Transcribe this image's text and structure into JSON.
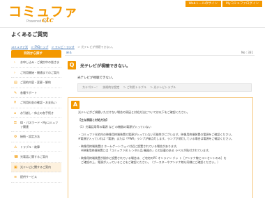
{
  "header": {
    "logo_text": "コミュファ",
    "logo_sub": "Powered by",
    "logo_ctc": "ctc",
    "buttons": [
      "Webトールのサイン",
      "Myコミュファログイン"
    ]
  },
  "page_title": "よくあるご質問",
  "breadcrumb": [
    "コミュファ光",
    "＞ FAQトップ",
    "＞ テレビ・ラジオ",
    "＞ 光テレビが視聴できない。"
  ],
  "sidebar": {
    "heading": "目的から探す",
    "items": [
      {
        "label": "お申し込み・ご検討中の皆さま"
      },
      {
        "label": "ご利用開始・開通までのご案内"
      },
      {
        "label": "ご契約内容・変更・解約"
      },
      {
        "label": "各種サポート"
      },
      {
        "label": "ご利用料金の確認・お支払い"
      },
      {
        "label": "お引越し・休止の各手続き"
      },
      {
        "label": "ID・パスワード・Myコミュファ関連"
      },
      {
        "label": "接続・設定方法"
      },
      {
        "label": "トラブル・故障"
      },
      {
        "label": "光電話に関するご案内"
      },
      {
        "label": "光テレビに関するご案内"
      },
      {
        "label": "提供サービス"
      }
    ]
  },
  "main": {
    "back_label": "戻る",
    "faq_no": "No : 331",
    "question_badge": "Q",
    "question": "光テレビが視聴できない。",
    "question_sub": "光テレビが視聴できない。",
    "categories": [
      "カテゴリー：",
      "技術的な設定",
      "＞ ご利用トラブル",
      "＞ 光テレビトラブル"
    ],
    "answer_badge": "A",
    "answer_lines": [
      "光テレビがご視聴いただけない場合の原因と対処方法については以下をご確認ください。",
      "",
      "【主な原因と対処方法】",
      "",
      "（1）光電話用等の電源 など の機器の電源が入っていない",
      "",
      "・コミュファ光宅内の映像用終端装置の電源が入っていない可能性がございます。映像用終端装置の電源をご確認ください。",
      "※電源が入っていれば「電源」または「PWR」ランプが緑点灯します。ランプが消灯している場合は電源をご確認ください。",
      "",
      "・映像用終端装置は ホームゲートウェイ付近に設置されている場合があります。",
      "　※映像用終端装置には「コミュファ光 レンタル品 機器の」との記載のある ラベルが貼付されています。",
      "",
      "・映像用終端装置が操作に設置されている場合は、ご宅宅のPC オンライン チャ ト［アンテナ線とコンセントのみ］を",
      "　ご確認の上、電源が入っていることをご確認ください。（ブースターやアンテナ線も同様にご確認ください。）"
    ]
  },
  "colors": {
    "brand": "#f39800",
    "link": "#3a6fb0"
  }
}
